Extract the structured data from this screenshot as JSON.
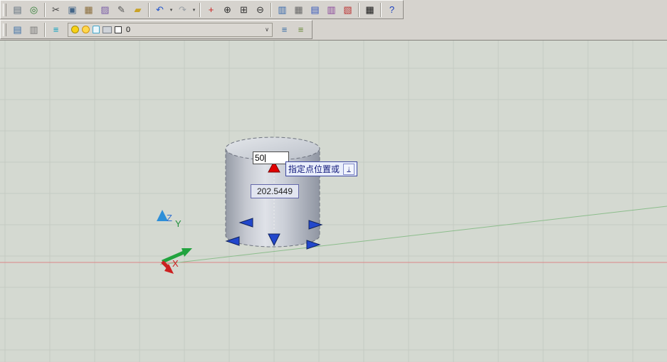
{
  "window": {
    "background": "#d6d3ce"
  },
  "toolbar_main": {
    "items": [
      {
        "name": "sheet-set",
        "glyph": "▤",
        "color": "#5f6f7d"
      },
      {
        "name": "publish-web",
        "glyph": "◎",
        "color": "#2e7d32"
      },
      {
        "type": "sep"
      },
      {
        "name": "cut",
        "glyph": "✂",
        "color": "#444444"
      },
      {
        "name": "copy",
        "glyph": "▣",
        "color": "#446688"
      },
      {
        "name": "paste",
        "glyph": "▦",
        "color": "#8a6d3b"
      },
      {
        "name": "match-properties",
        "glyph": "▨",
        "color": "#7b5ea7"
      },
      {
        "name": "pencil-edit",
        "glyph": "✎",
        "color": "#555555"
      },
      {
        "name": "brush",
        "glyph": "▰",
        "color": "#c9a227"
      },
      {
        "type": "sep"
      },
      {
        "name": "undo",
        "glyph": "↶",
        "color": "#2255cc",
        "drop": true
      },
      {
        "name": "redo",
        "glyph": "↷",
        "color": "#9aa0a6",
        "drop": true
      },
      {
        "type": "sep"
      },
      {
        "name": "pan-realtime",
        "glyph": "+",
        "color": "#cc2222"
      },
      {
        "name": "zoom-realtime",
        "glyph": "⊕",
        "color": "#333333"
      },
      {
        "name": "zoom-window",
        "glyph": "⊞",
        "color": "#333333"
      },
      {
        "name": "zoom-previous",
        "glyph": "⊖",
        "color": "#333333"
      },
      {
        "type": "sep"
      },
      {
        "name": "properties-palette",
        "glyph": "▥",
        "color": "#3366aa"
      },
      {
        "name": "design-center",
        "glyph": "▦",
        "color": "#666666"
      },
      {
        "name": "tool-palettes",
        "glyph": "▤",
        "color": "#3355bb"
      },
      {
        "name": "sheet-set-manager",
        "glyph": "▥",
        "color": "#884499"
      },
      {
        "name": "markup-set-manager",
        "glyph": "▧",
        "color": "#bb3333"
      },
      {
        "type": "sep"
      },
      {
        "name": "quick-calc",
        "glyph": "▦",
        "color": "#111111"
      },
      {
        "type": "sep"
      },
      {
        "name": "help",
        "glyph": "?",
        "color": "#1a3fbf"
      }
    ]
  },
  "toolbar_layers": {
    "items_left": [
      {
        "name": "layer-properties",
        "glyph": "▤",
        "color": "#3a6ea5"
      },
      {
        "name": "layer-states",
        "glyph": "▥",
        "color": "#777777"
      },
      {
        "type": "sep"
      },
      {
        "name": "layers",
        "glyph": "≡",
        "color": "#0aa0c0"
      }
    ],
    "combo": {
      "current_layer": "0",
      "arrow": "∨"
    },
    "items_right": [
      {
        "name": "make-object-layer-current",
        "glyph": "≡",
        "color": "#3a6ea5"
      },
      {
        "name": "layer-previous",
        "glyph": "≡",
        "color": "#6a8a3a"
      }
    ]
  },
  "viewport": {
    "background": "#d4d9d1",
    "grid_color": "#c5cbc3",
    "axis_colors": {
      "x_line": "#dc8686",
      "y_line": "#8cbd8c"
    },
    "dynamic_input": {
      "value": "50"
    },
    "tooltip": {
      "text": "指定点位置或",
      "key_hint": "↓"
    },
    "dimension": {
      "value": "202.5449"
    },
    "ucs": {
      "x": "X",
      "y": "Y",
      "z": "Z"
    }
  }
}
